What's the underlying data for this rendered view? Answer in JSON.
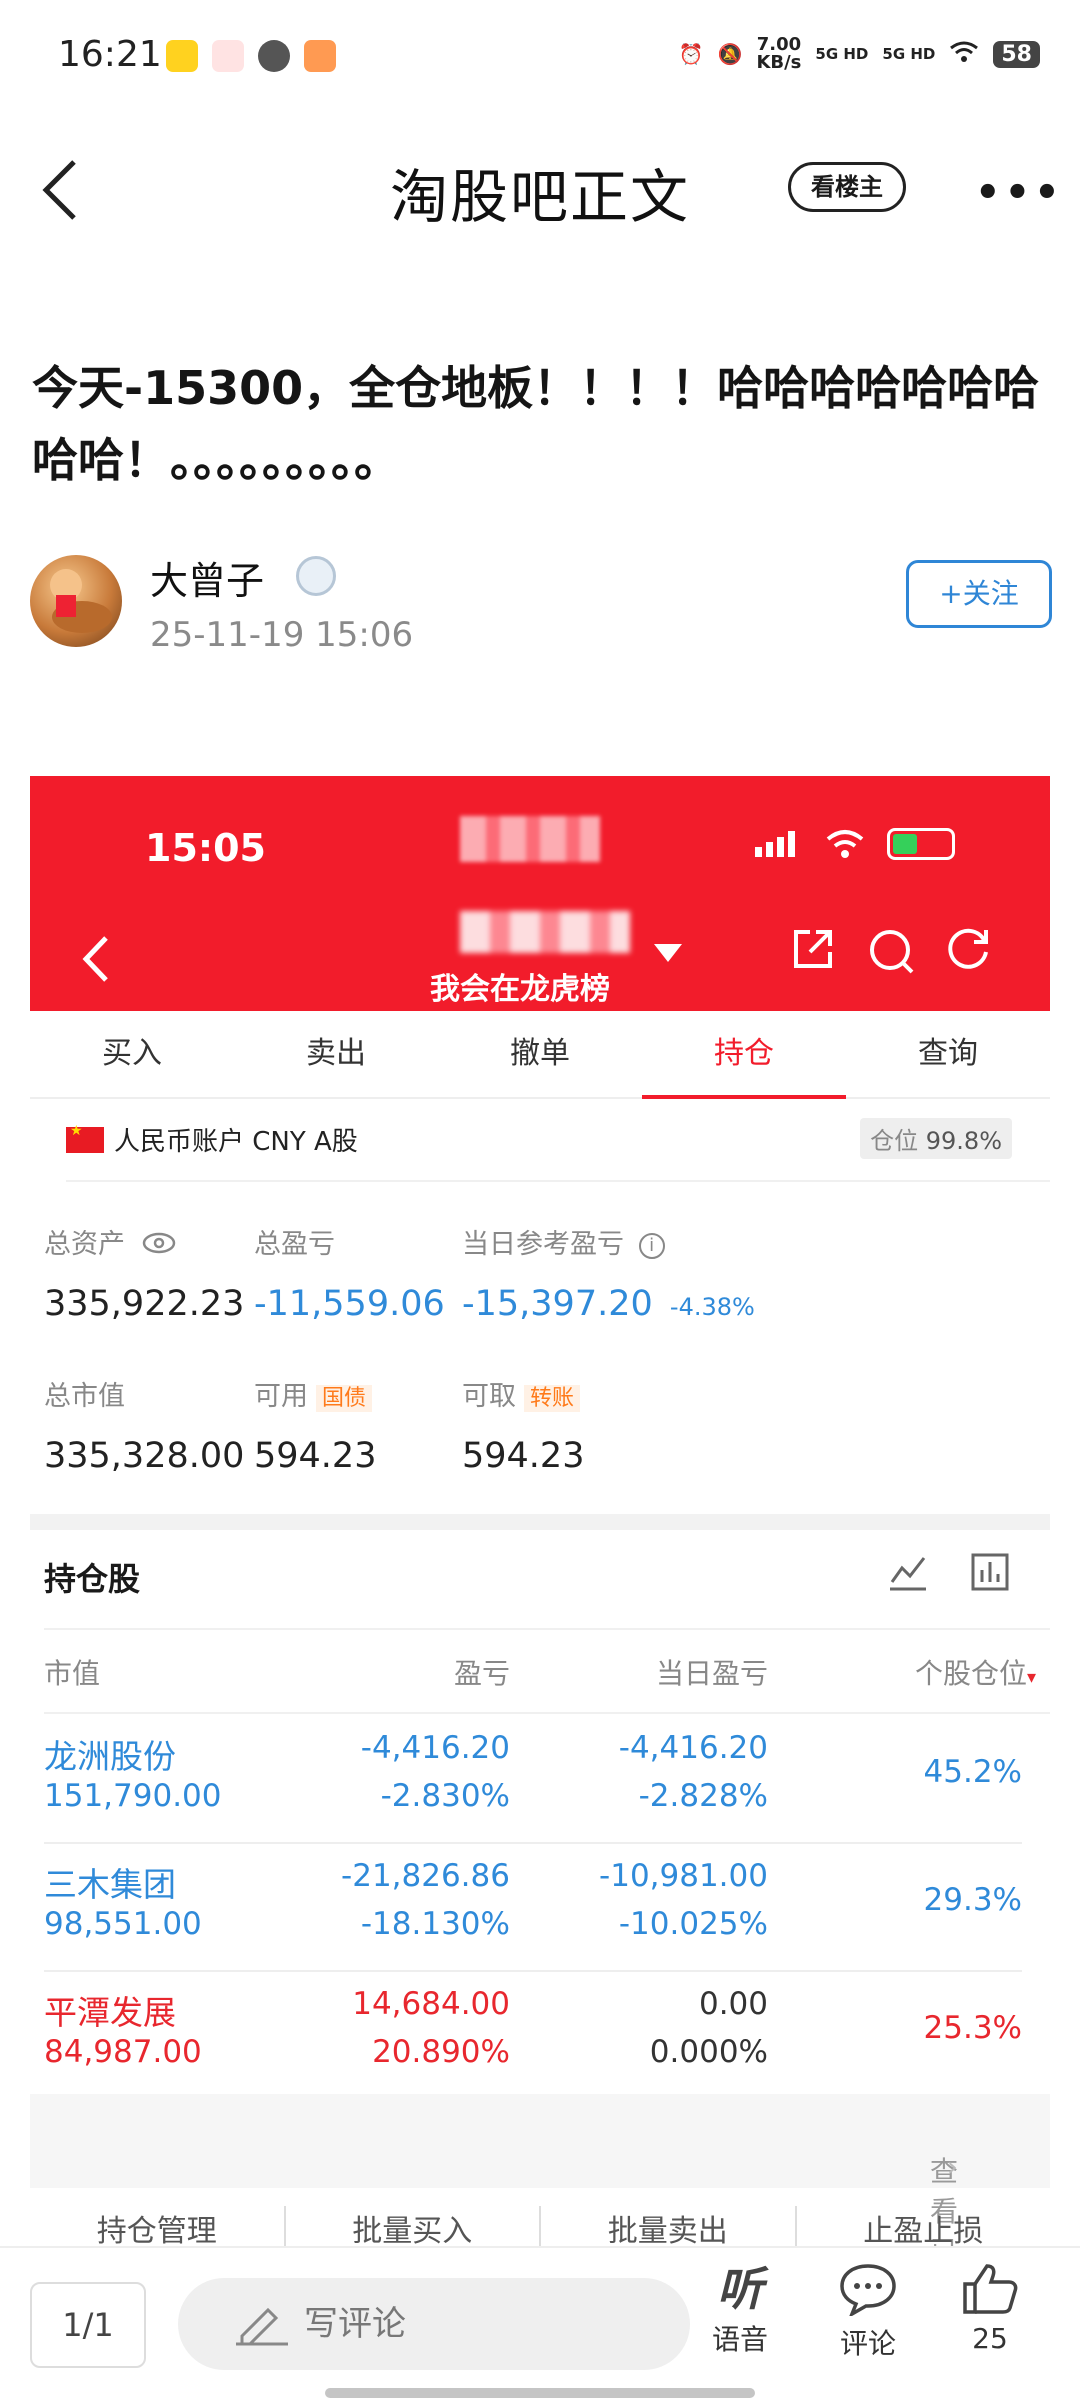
{
  "status_bar": {
    "time": "16:21",
    "net_speed_value": "7.00",
    "net_speed_unit": "KB/s",
    "sig1": "5G HD",
    "sig2": "5G HD",
    "battery": "58"
  },
  "nav": {
    "title": "淘股吧正文",
    "louzhu": "看楼主",
    "more": "•••"
  },
  "post": {
    "title": "今天-15300，全仓地板！！！！哈哈哈哈哈哈哈哈哈！。。。。。。。。。",
    "author": "大曾子",
    "time": "25-11-19 15:06",
    "follow": "+关注"
  },
  "screenshot": {
    "time": "15:05",
    "subtitle": "我会在龙虎榜",
    "tabs": [
      {
        "label": "买入"
      },
      {
        "label": "卖出"
      },
      {
        "label": "撤单"
      },
      {
        "label": "持仓"
      },
      {
        "label": "查询"
      }
    ],
    "account": "人民币账户 CNY A股",
    "position_label": "仓位",
    "position_value": "99.8%",
    "metrics": {
      "total_assets_label": "总资产",
      "total_assets": "335,922.23",
      "total_pl_label": "总盈亏",
      "total_pl": "-11,559.06",
      "daily_pl_label": "当日参考盈亏",
      "daily_pl": "-15,397.20",
      "daily_pl_pct": "-4.38%",
      "market_value_label": "总市值",
      "market_value": "335,328.00",
      "available_label": "可用",
      "available_tag": "国债",
      "available": "594.23",
      "withdrawable_label": "可取",
      "withdrawable_tag": "转账",
      "withdrawable": "594.23"
    },
    "holdings_title": "持仓股",
    "columns": [
      "市值",
      "盈亏",
      "当日盈亏",
      "个股仓位"
    ],
    "holdings": [
      {
        "name": "龙洲股份",
        "market_value": "151,790.00",
        "pl": "-4,416.20",
        "pl_pct": "-2.830%",
        "daily_pl": "-4,416.20",
        "daily_pct": "-2.828%",
        "weight": "45.2%",
        "color": "#2f8ad9"
      },
      {
        "name": "三木集团",
        "market_value": "98,551.00",
        "pl": "-21,826.86",
        "pl_pct": "-18.130%",
        "daily_pl": "-10,981.00",
        "daily_pct": "-10.025%",
        "weight": "29.3%",
        "color": "#2f8ad9"
      },
      {
        "name": "平潭发展",
        "market_value": "84,987.00",
        "pl": "14,684.00",
        "pl_pct": "20.890%",
        "daily_pl": "0.00",
        "daily_pct": "0.000%",
        "weight": "25.3%",
        "color": "#e8272e"
      }
    ],
    "view_cleared": "查看已清仓股票",
    "manage": [
      "持仓管理",
      "批量买入",
      "批量卖出",
      "止盈止损"
    ]
  },
  "bottom": {
    "page": "1/1",
    "comment_placeholder": "写评论",
    "voice": "语音",
    "comment": "评论",
    "likes": "25"
  }
}
